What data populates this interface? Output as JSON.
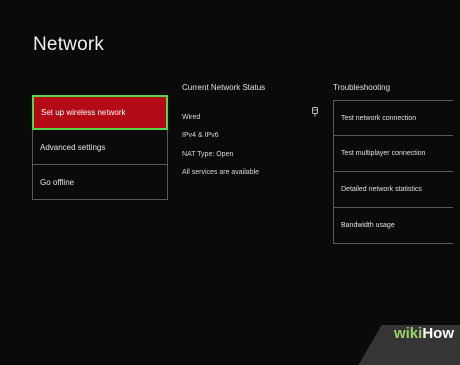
{
  "page": {
    "title": "Network"
  },
  "left_menu": {
    "items": [
      {
        "label": "Set up wireless network",
        "selected": true
      },
      {
        "label": "Advanced settings",
        "selected": false
      },
      {
        "label": "Go offline",
        "selected": false
      }
    ]
  },
  "status": {
    "heading": "Current Network Status",
    "lines": [
      "Wired",
      "IPv4 & IPv6",
      "NAT Type: Open",
      "All services are available"
    ],
    "icon": "ethernet-connector-icon"
  },
  "troubleshooting": {
    "heading": "Troubleshooting",
    "items": [
      {
        "label": "Test network connection"
      },
      {
        "label": "Test multiplayer connection"
      },
      {
        "label": "Detailed network statistics"
      },
      {
        "label": "Bandwidth usage"
      }
    ]
  },
  "watermark": {
    "part1": "wiki",
    "part2": "How"
  },
  "colors": {
    "background": "#0a0a0a",
    "selected_fill": "#b30a16",
    "selected_border": "#59d34a",
    "divider": "#5a5a5a"
  }
}
